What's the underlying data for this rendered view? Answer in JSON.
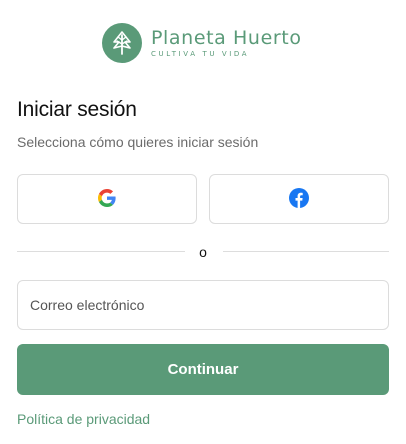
{
  "brand": {
    "name": "Planeta Huerto",
    "tagline": "CULTIVA TU VIDA",
    "color": "#5a9a78",
    "logo_icon": "leaf-icon"
  },
  "login": {
    "title": "Iniciar sesión",
    "subtitle": "Selecciona cómo quieres iniciar sesión",
    "social": [
      {
        "provider": "Google",
        "icon": "google-icon"
      },
      {
        "provider": "Facebook",
        "icon": "facebook-icon",
        "color": "#1877f2"
      }
    ],
    "divider_text": "o",
    "email_placeholder": "Correo electrónico",
    "email_value": "",
    "continue_label": "Continuar",
    "privacy_link": "Política de privacidad"
  }
}
